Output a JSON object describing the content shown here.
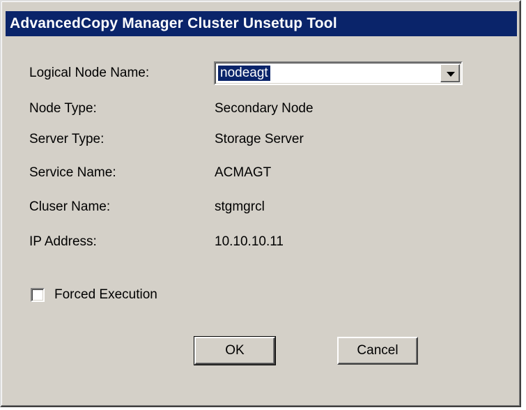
{
  "window": {
    "title": "AdvancedCopy Manager Cluster Unsetup Tool"
  },
  "fields": {
    "logical_node_name_label": "Logical Node Name:",
    "logical_node_name_value": "nodeagt",
    "node_type_label": "Node Type:",
    "node_type_value": "Secondary Node",
    "server_type_label": "Server Type:",
    "server_type_value": "Storage Server",
    "service_name_label": "Service Name:",
    "service_name_value": "ACMAGT",
    "cluster_name_label": "Cluser Name:",
    "cluster_name_value": "stgmgrcl",
    "ip_address_label": "IP Address:",
    "ip_address_value": "10.10.10.11"
  },
  "options": {
    "forced_execution_label": "Forced Execution",
    "forced_execution_checked": false
  },
  "buttons": {
    "ok_label": "OK",
    "cancel_label": "Cancel"
  },
  "icons": {
    "dropdown": "chevron-down-icon"
  },
  "colors": {
    "titlebar": "#0a246a",
    "dialog_bg": "#d4d0c8",
    "selection": "#0a246a"
  }
}
